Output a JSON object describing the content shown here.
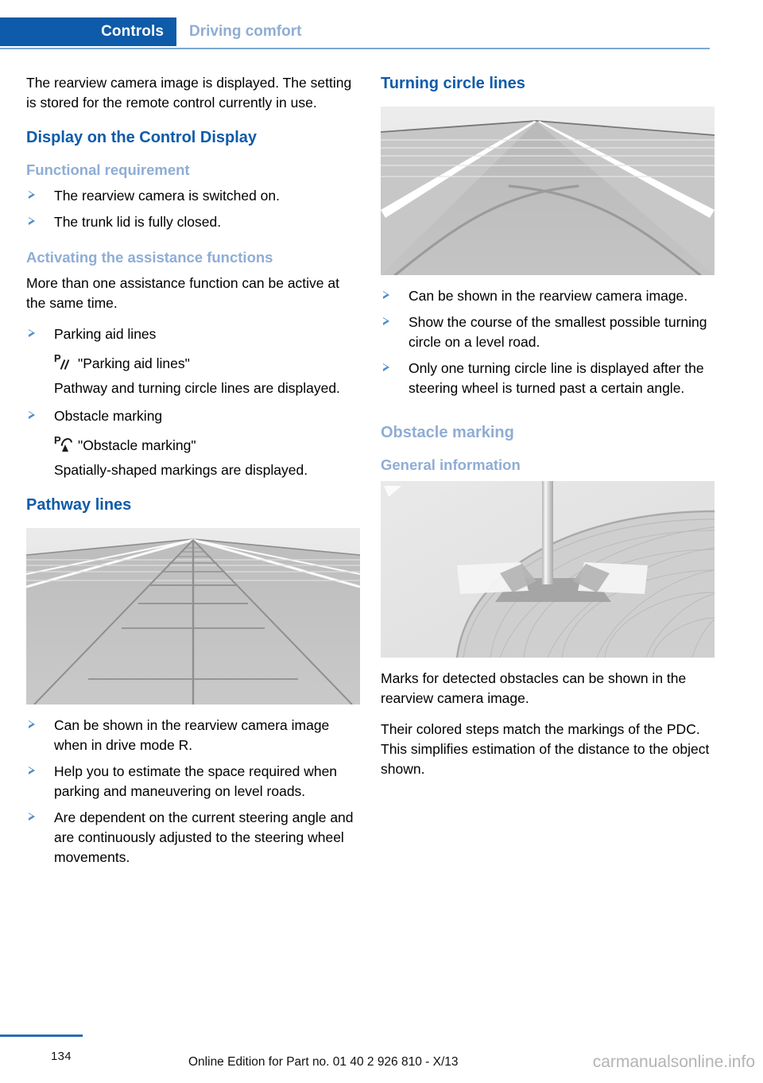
{
  "header": {
    "active_tab": "Controls",
    "inactive_tab": "Driving comfort"
  },
  "left_column": {
    "intro_paragraph": "The rearview camera image is displayed. The setting is stored for the remote control currently in use.",
    "section_heading": "Display on the Control Display",
    "functional_requirement": {
      "heading": "Functional requirement",
      "bullets": [
        "The rearview camera is switched on.",
        "The trunk lid is fully closed."
      ]
    },
    "activating": {
      "heading": "Activating the assistance functions",
      "intro": "More than one assistance function can be active at the same time.",
      "item1_label": "Parking aid lines",
      "item1_icon": "parking-aid-lines-icon",
      "item1_menu": "\"Parking aid lines\"",
      "item1_desc": "Pathway and turning circle lines are displayed.",
      "item2_label": "Obstacle marking",
      "item2_icon": "obstacle-marking-icon",
      "item2_menu": "\"Obstacle marking\"",
      "item2_desc": "Spatially-shaped markings are displayed."
    },
    "pathway_lines": {
      "heading": "Pathway lines",
      "figure_caption": "pathway-lines-camera-view",
      "bullets": [
        "Can be shown in the rearview camera image when in drive mode R.",
        "Help you to estimate the space required when parking and maneuvering on level roads.",
        "Are dependent on the current steering angle and are continuously adjusted to the steering wheel movements."
      ]
    }
  },
  "right_column": {
    "turning_circle": {
      "heading": "Turning circle lines",
      "figure_caption": "turning-circle-lines-camera-view",
      "bullets": [
        "Can be shown in the rearview camera image.",
        "Show the course of the smallest possible turning circle on a level road.",
        "Only one turning circle line is displayed after the steering wheel is turned past a certain angle."
      ]
    },
    "obstacle_marking": {
      "heading": "Obstacle marking",
      "sub_heading": "General information",
      "figure_caption": "obstacle-marking-camera-view",
      "paragraph1": "Marks for detected obstacles can be shown in the rearview camera image.",
      "paragraph2": "Their colored steps match the markings of the PDC. This simplifies estimation of the distance to the object shown."
    }
  },
  "footer": {
    "page_number": "134",
    "edition_text": "Online Edition for Part no. 01 40 2 926 810 - X/13",
    "watermark": "carmanualsonline.info"
  },
  "colors": {
    "tab_active_bg": "#0d5ba9",
    "tab_inactive_text": "#8fadd4",
    "heading_blue": "#0d5ba9",
    "heading_light_blue": "#8fadd4",
    "bullet_triangle": "#4c8ccb",
    "footer_rule": "#2a6bb5"
  }
}
